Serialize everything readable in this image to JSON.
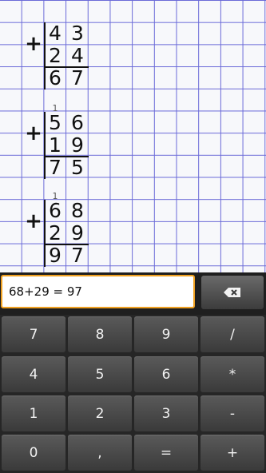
{
  "problems": [
    {
      "carries": [
        "",
        ""
      ],
      "top": [
        "4",
        "3"
      ],
      "bottom": [
        "2",
        "4"
      ],
      "result": [
        "6",
        "7"
      ],
      "operator": "+"
    },
    {
      "carries": [
        "1",
        ""
      ],
      "top": [
        "5",
        "6"
      ],
      "bottom": [
        "1",
        "9"
      ],
      "result": [
        "7",
        "5"
      ],
      "operator": "+"
    },
    {
      "carries": [
        "1",
        ""
      ],
      "top": [
        "6",
        "8"
      ],
      "bottom": [
        "2",
        "9"
      ],
      "result": [
        "9",
        "7"
      ],
      "operator": "+"
    }
  ],
  "input": {
    "value": "68+29 = 97"
  },
  "backspace": {
    "icon": "backspace-icon"
  },
  "keys": [
    [
      "7",
      "8",
      "9",
      "/"
    ],
    [
      "4",
      "5",
      "6",
      "*"
    ],
    [
      "1",
      "2",
      "3",
      "-"
    ],
    [
      "0",
      ",",
      "=",
      "+"
    ]
  ],
  "colors": {
    "grid_line": "#6a6ad8",
    "input_border": "#f0a020",
    "key_face": "#4a4a4a"
  }
}
